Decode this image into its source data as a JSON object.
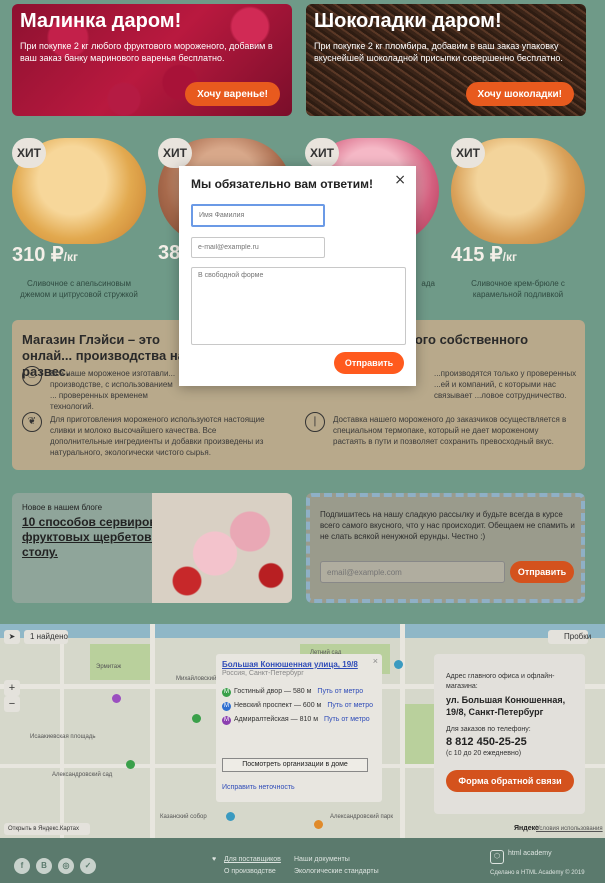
{
  "promos": [
    {
      "title": "Малинка даром!",
      "text": "При покупке 2 кг любого фруктового мороженого, добавим в ваш заказ банку маринового варенья бесплатно.",
      "button": "Хочу варенье!"
    },
    {
      "title": "Шоколадки даром!",
      "text": "При покупке 2 кг пломбира, добавим в ваш заказ упаковку вкуснейшей шоколадной присыпки совершенно бесплатно.",
      "button": "Хочу шоколадки!"
    }
  ],
  "products": [
    {
      "badge": "ХИТ",
      "price": "310 ₽",
      "unit": "/кг",
      "desc": "Сливочное с апельсиновым джемом и цитрусовой стружкой"
    },
    {
      "badge": "ХИТ",
      "price": "38",
      "unit": "",
      "desc": ""
    },
    {
      "badge": "ХИТ",
      "price": "",
      "unit": "",
      "desc": "ада"
    },
    {
      "badge": "ХИТ",
      "price": "415 ₽",
      "unit": "/кг",
      "desc": "Сливочное крем-брюле с карамельной подливкой"
    }
  ],
  "info": {
    "title_left": "Магазин Глэйси – это онлай... производства на развес.",
    "title_right": "...ого собственного",
    "items": [
      "Все наше мороженое изготавли... производстве, с использованием ... проверенных временем технологий.",
      "...производятся только у проверенных ...ей и компаний, с которыми нас связывает ...ловое сотрудничество.",
      "Для приготовления мороженого используются настоящие сливки и молоко высочайшего качества. Все дополнительные ингредиенты и добавки произведены из натурального, экологически чистого сырья.",
      "Доставка нашего мороженого до заказчиков осуществляется в специальном термопаке, который не дает мороженому растаять в пути и позволяет сохранить превосходный вкус."
    ]
  },
  "blog": {
    "kicker": "Новое в нашем блоге",
    "title": "10 способов сервировки фруктовых щербетов к столу."
  },
  "subscribe": {
    "text": "Подпишитесь на нашу сладкую рассылку и будьте всегда в курсе всего самого вкусного, что у нас происходит. Обещаем не спамить и не слать всякой ненужной ерунды. Честно :)",
    "placeholder": "email@example.com",
    "button": "Отправить"
  },
  "map": {
    "found": "1 найдено",
    "traffic": "Пробки",
    "open_yandex": "Открыть в Яндекс.Картах",
    "yandex": "Яндекс",
    "terms": "Условия использования",
    "balloon": {
      "title": "Большая Конюшенная улица, 19/8",
      "subtitle": "Россия, Санкт-Петербург",
      "metro": [
        {
          "name": "Гостиный двор — 580 м",
          "way": "Путь от метро",
          "color": "#3aa04a"
        },
        {
          "name": "Невский проспект — 600 м",
          "way": "Путь от метро",
          "color": "#2f6fd0"
        },
        {
          "name": "Адмиралтейская — 810 м",
          "way": "Путь от метро",
          "color": "#8b3fb0"
        }
      ],
      "orgs": "Посмотреть организации в доме",
      "fix": "Исправить неточность"
    },
    "labels": {
      "l1": "Михайловский сад",
      "l2": "Летний сад",
      "l3": "Александровский сад",
      "l4": "Исаакиевская площадь",
      "l5": "Эрмитаж",
      "l6": "Казанский собор",
      "l7": "Александровский парк"
    },
    "card": {
      "head": "Адрес главного офиса и офлайн-магазина:",
      "address": "ул. Большая Конюшенная, 19/8, Санкт-Петербург",
      "phone_label": "Для заказов по телефону:",
      "phone": "8 812 450-25-25",
      "hours": "(с 10 до 20 ежедневно)",
      "button": "Форма обратной связи"
    }
  },
  "footer": {
    "links": [
      "Для поставщиков",
      "О производстве",
      "Наши документы",
      "Экологические стандарты"
    ],
    "brand": "html academy",
    "copyright": "Сделано в HTML Academy © 2019"
  },
  "modal": {
    "title": "Мы обязательно вам ответим!",
    "close": "×",
    "name_placeholder": "Имя Фамилия",
    "email_placeholder": "e-mail@example.ru",
    "message_placeholder": "В свободной форме",
    "submit": "Отправить"
  }
}
